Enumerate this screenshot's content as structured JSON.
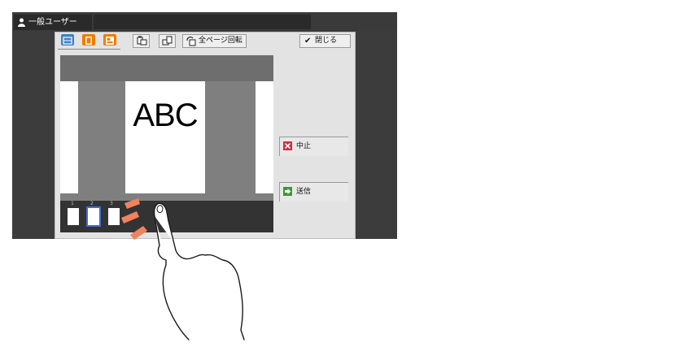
{
  "topbar": {
    "user_label": "一般ユーザー"
  },
  "toolbar": {
    "rotate_all_label": "全ページ回転",
    "close_label": "閉じる"
  },
  "preview": {
    "page_text": "ABC"
  },
  "thumbnails": [
    {
      "number": "1"
    },
    {
      "number": "2"
    },
    {
      "number": "3"
    }
  ],
  "side": {
    "cancel_label": "中止",
    "send_label": "送信"
  },
  "colors": {
    "accent_orange": "#f07c00",
    "selection_blue": "#3f6bd8",
    "cancel_red": "#e0273a",
    "send_green": "#3a9a2f",
    "tap_marks": "#f0825e"
  }
}
